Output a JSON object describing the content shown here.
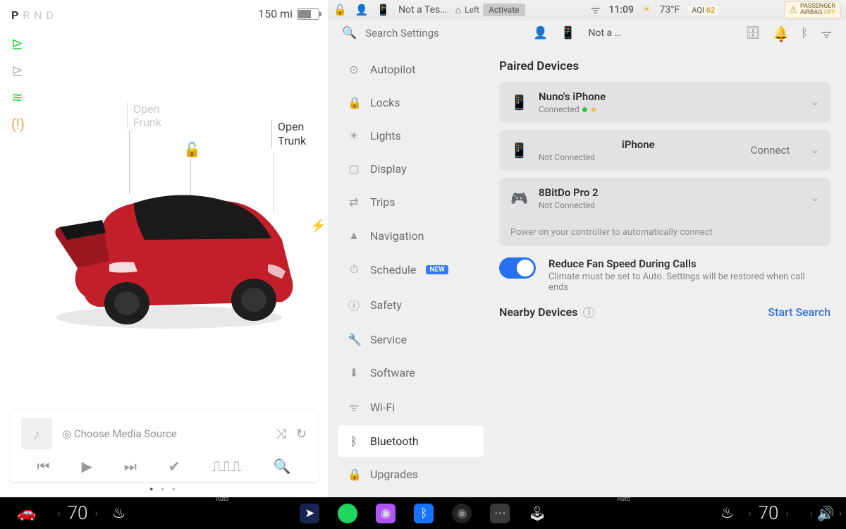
{
  "left": {
    "gear": [
      "P",
      "R",
      "N",
      "D"
    ],
    "gear_selected": "P",
    "range": "150 mi",
    "frunk_label_line1": "Open",
    "frunk_label_line2": "Frunk",
    "trunk_label_line1": "Open",
    "trunk_label_line2": "Trunk",
    "media_source": "Choose Media Source"
  },
  "status": {
    "profile": "Not a Tes…",
    "homelink": "Left",
    "activate": "Activate",
    "time": "11:09",
    "temp": "73°F",
    "aqi_label": "AQI",
    "aqi_value": "62",
    "airbag_line1": "PASSENGER",
    "airbag_line2": "AIRBAG",
    "airbag_off": "OFF"
  },
  "subbar": {
    "search_placeholder": "Search Settings",
    "profile_short": "Not a …"
  },
  "nav": {
    "items": [
      {
        "icon": "⊙",
        "label": "Autopilot"
      },
      {
        "icon": "🔒",
        "label": "Locks"
      },
      {
        "icon": "☀",
        "label": "Lights"
      },
      {
        "icon": "▢",
        "label": "Display"
      },
      {
        "icon": "⇄",
        "label": "Trips"
      },
      {
        "icon": "▲",
        "label": "Navigation"
      },
      {
        "icon": "⏱",
        "label": "Schedule",
        "badge": "NEW"
      },
      {
        "icon": "ⓘ",
        "label": "Safety"
      },
      {
        "icon": "🔧",
        "label": "Service"
      },
      {
        "icon": "⬇",
        "label": "Software"
      },
      {
        "icon": "ᯤ",
        "label": "Wi-Fi"
      },
      {
        "icon": "ᛒ",
        "label": "Bluetooth",
        "active": true
      },
      {
        "icon": "🔒",
        "label": "Upgrades"
      }
    ]
  },
  "content": {
    "paired_title": "Paired Devices",
    "dev1_name": "Nuno's iPhone",
    "dev1_status": "Connected",
    "dev2_name": "iPhone",
    "dev2_status": "Not Connected",
    "dev2_action": "Connect",
    "dev3_name": "8BitDo Pro 2",
    "dev3_status": "Not Connected",
    "dev3_hint": "Power on your controller to automatically connect",
    "toggle_title": "Reduce Fan Speed During Calls",
    "toggle_sub": "Climate must be set to Auto. Settings will be restored when call ends",
    "nearby_title": "Nearby Devices",
    "start_search": "Start Search"
  },
  "dock": {
    "auto": "Auto",
    "temp_left": "70",
    "temp_right": "70"
  }
}
